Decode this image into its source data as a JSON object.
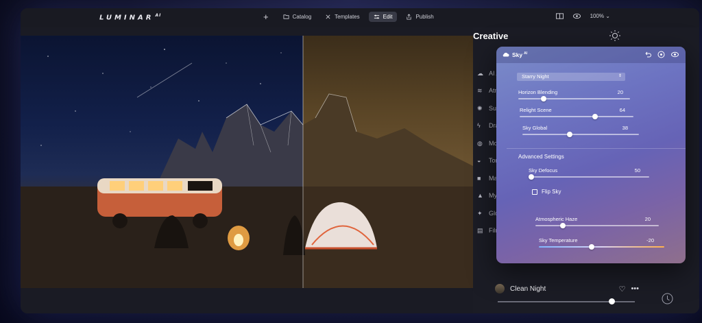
{
  "app": {
    "name": "LUMINAR",
    "name_sup": "AI"
  },
  "nav": {
    "items": [
      {
        "label": "Catalog",
        "icon": "folder-icon"
      },
      {
        "label": "Templates",
        "icon": "templates-icon"
      },
      {
        "label": "Edit",
        "icon": "sliders-icon",
        "active": true
      },
      {
        "label": "Publish",
        "icon": "share-icon"
      }
    ],
    "zoom": "100%"
  },
  "panel": {
    "title": "Creative",
    "tools": [
      {
        "label": "AI A",
        "icon": "cloud-icon"
      },
      {
        "label": "Atm",
        "icon": "waves-icon"
      },
      {
        "label": "Sun",
        "icon": "sun-icon"
      },
      {
        "label": "Dra",
        "icon": "bolt-icon"
      },
      {
        "label": "Moo",
        "icon": "mood-icon"
      },
      {
        "label": "Ton",
        "icon": "tone-icon"
      },
      {
        "label": "Matt",
        "icon": "square-icon"
      },
      {
        "label": "Myst",
        "icon": "figure-icon"
      },
      {
        "label": "Glow",
        "icon": "sparkle-icon"
      },
      {
        "label": "Film",
        "icon": "film-icon"
      }
    ],
    "preset": {
      "name": "Clean Night",
      "amount": 0.83
    }
  },
  "sky": {
    "title": "Sky",
    "title_sup": "AI",
    "dropdown": "Starry Night",
    "sliders": [
      {
        "label": "Horizon Blending",
        "value": "20",
        "pos": 0.2
      },
      {
        "label": "Relight Scene",
        "value": "64",
        "pos": 0.64
      },
      {
        "label": "Sky Global",
        "value": "38",
        "pos": 0.38
      }
    ],
    "advanced_label": "Advanced Settings",
    "advanced": [
      {
        "label": "Sky Defocus",
        "value": "50",
        "pos": 0.0
      },
      {
        "label": "Atmospheric Haze",
        "value": "20",
        "pos": 0.2
      },
      {
        "label": "Sky Temperature",
        "value": "-20",
        "pos": 0.4
      }
    ],
    "flip_label": "Flip Sky"
  }
}
